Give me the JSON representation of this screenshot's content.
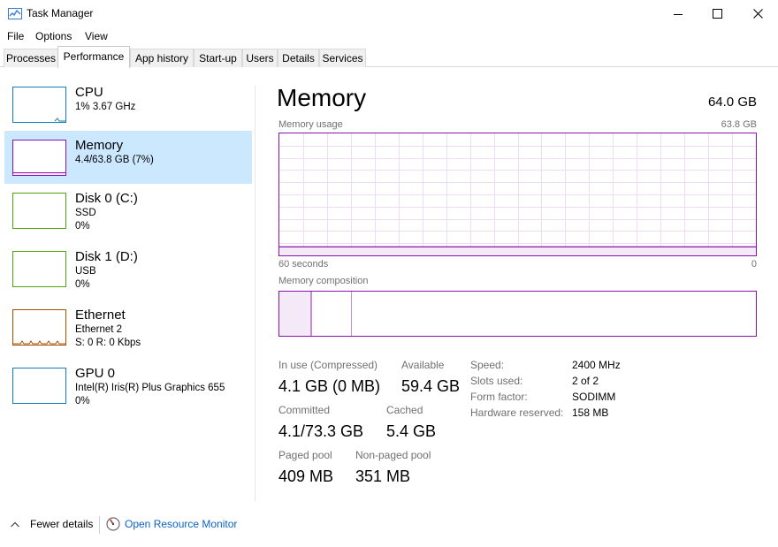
{
  "window": {
    "title": "Task Manager"
  },
  "menu": [
    "File",
    "Options",
    "View"
  ],
  "tabs": [
    "Processes",
    "Performance",
    "App history",
    "Start-up",
    "Users",
    "Details",
    "Services"
  ],
  "active_tab": "Performance",
  "sidebar": {
    "items": [
      {
        "title": "CPU",
        "lines": [
          "1% 3.67 GHz"
        ],
        "color": "#117dbb",
        "selected": false
      },
      {
        "title": "Memory",
        "lines": [
          "4.4/63.8 GB (7%)"
        ],
        "color": "#8b12ae",
        "selected": true
      },
      {
        "title": "Disk 0 (C:)",
        "lines": [
          "SSD",
          "0%"
        ],
        "color": "#4da60c",
        "selected": false
      },
      {
        "title": "Disk 1 (D:)",
        "lines": [
          "USB",
          "0%"
        ],
        "color": "#4da60c",
        "selected": false
      },
      {
        "title": "Ethernet",
        "lines": [
          "Ethernet 2",
          "S: 0 R: 0 Kbps"
        ],
        "color": "#a74f01",
        "selected": false
      },
      {
        "title": "GPU 0",
        "lines": [
          "Intel(R) Iris(R) Plus Graphics 655",
          "0%"
        ],
        "color": "#117dbb",
        "selected": false
      }
    ]
  },
  "main": {
    "title": "Memory",
    "total": "64.0 GB",
    "usage_label": "Memory usage",
    "usage_max": "63.8 GB",
    "time_left": "60 seconds",
    "time_right": "0",
    "composition_label": "Memory composition",
    "usage_fraction": 0.07,
    "stats": {
      "in_use_label": "In use (Compressed)",
      "in_use_value": "4.1 GB (0 MB)",
      "available_label": "Available",
      "available_value": "59.4 GB",
      "committed_label": "Committed",
      "committed_value": "4.1/73.3 GB",
      "cached_label": "Cached",
      "cached_value": "5.4 GB",
      "paged_label": "Paged pool",
      "paged_value": "409 MB",
      "nonpaged_label": "Non-paged pool",
      "nonpaged_value": "351 MB"
    },
    "specs": [
      {
        "label": "Speed:",
        "value": "2400 MHz"
      },
      {
        "label": "Slots used:",
        "value": "2 of 2"
      },
      {
        "label": "Form factor:",
        "value": "SODIMM"
      },
      {
        "label": "Hardware reserved:",
        "value": "158 MB"
      }
    ]
  },
  "footer": {
    "fewer_details": "Fewer details",
    "open_resource_monitor": "Open Resource Monitor"
  },
  "colors": {
    "accent": "#8b12ae",
    "selection": "#cce8ff",
    "link": "#0b63c4"
  }
}
